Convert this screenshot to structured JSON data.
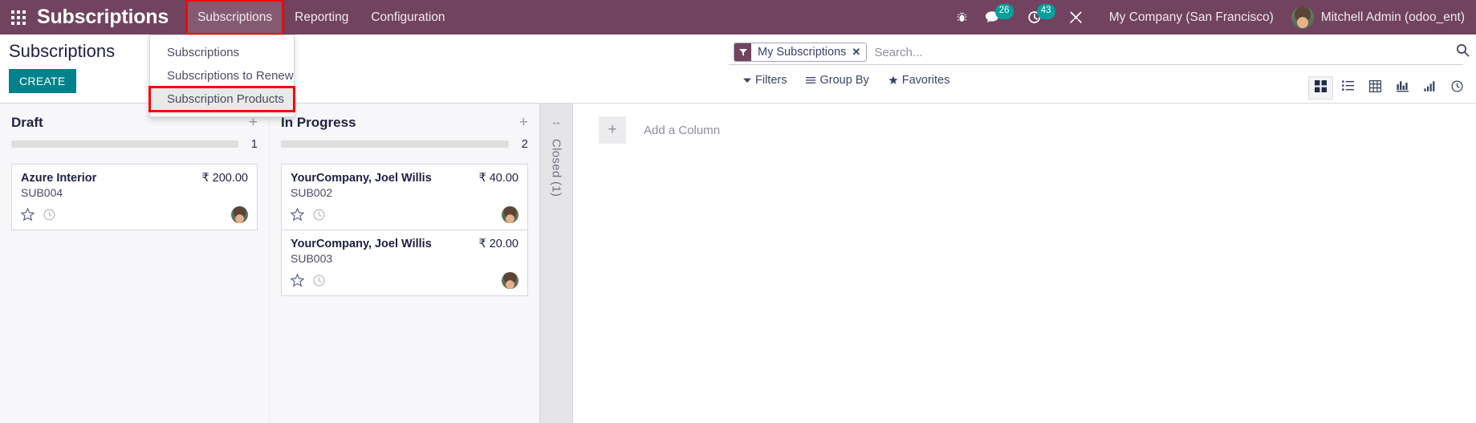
{
  "navbar": {
    "apps_icon": "apps-grid-icon",
    "brand": "Subscriptions",
    "menus": [
      {
        "label": "Subscriptions",
        "active": true,
        "highlighted": true
      },
      {
        "label": "Reporting",
        "active": false,
        "highlighted": false
      },
      {
        "label": "Configuration",
        "active": false,
        "highlighted": false
      }
    ],
    "systray": {
      "debug_icon": "bug-icon",
      "messages_icon": "chat-bubble-icon",
      "messages_count": "26",
      "activities_icon": "clock-icon",
      "activities_count": "43",
      "tools_icon": "wrench-screwdriver-icon",
      "company": "My Company (San Francisco)",
      "user": "Mitchell Admin (odoo_ent)",
      "avatar": "user-avatar"
    }
  },
  "dropdown": {
    "items": [
      {
        "label": "Subscriptions",
        "selected": false,
        "highlighted": false
      },
      {
        "label": "Subscriptions to Renew",
        "selected": false,
        "highlighted": false
      },
      {
        "label": "Subscription Products",
        "selected": true,
        "highlighted": true
      }
    ]
  },
  "control_panel": {
    "title": "Subscriptions",
    "create_label": "CREATE",
    "search": {
      "facet_icon": "filter-funnel-icon",
      "facet_label": "My Subscriptions",
      "facet_remove_icon": "close-x-icon",
      "placeholder": "Search...",
      "value": "",
      "magnifier_icon": "search-icon"
    },
    "filter_buttons": [
      {
        "label": "Filters",
        "icon": "caret-down-icon"
      },
      {
        "label": "Group By",
        "icon": "hamburger-icon"
      },
      {
        "label": "Favorites",
        "icon": "star-icon"
      }
    ],
    "views": [
      {
        "name": "kanban-view",
        "icon": "kanban-icon",
        "active": true
      },
      {
        "name": "list-view",
        "icon": "list-icon",
        "active": false
      },
      {
        "name": "pivot-view",
        "icon": "pivot-table-icon",
        "active": false
      },
      {
        "name": "graph-view",
        "icon": "bar-chart-icon",
        "active": false
      },
      {
        "name": "chart-view",
        "icon": "ascending-bars-icon",
        "active": false
      },
      {
        "name": "cohort-view",
        "icon": "clock-icon",
        "active": false
      }
    ]
  },
  "kanban": {
    "columns": [
      {
        "title": "Draft",
        "count": "1",
        "add_icon": "plus-icon",
        "cards": [
          {
            "name": "Azure Interior",
            "amount": "₹ 200.00",
            "reference": "SUB004",
            "star_icon": "star-outline-icon",
            "clock_icon": "clock-icon",
            "avatar": "assigned-user-avatar"
          }
        ]
      },
      {
        "title": "In Progress",
        "count": "2",
        "add_icon": "plus-icon",
        "cards": [
          {
            "name": "YourCompany, Joel Willis",
            "amount": "₹ 40.00",
            "reference": "SUB002",
            "star_icon": "star-outline-icon",
            "clock_icon": "clock-icon",
            "avatar": "assigned-user-avatar"
          },
          {
            "name": "YourCompany, Joel Willis",
            "amount": "₹ 20.00",
            "reference": "SUB003",
            "star_icon": "star-outline-icon",
            "clock_icon": "clock-icon",
            "avatar": "assigned-user-avatar"
          }
        ]
      }
    ],
    "folded_column": {
      "label": "Closed (1)",
      "expand_icon": "arrows-horizontal-icon"
    },
    "add_column": {
      "plus_icon": "plus-icon",
      "label": "Add a Column"
    }
  },
  "colors": {
    "brand_purple": "#71435f",
    "accent_teal": "#00828c",
    "badge_teal": "#00a09d",
    "highlight_red": "#ff0000"
  }
}
